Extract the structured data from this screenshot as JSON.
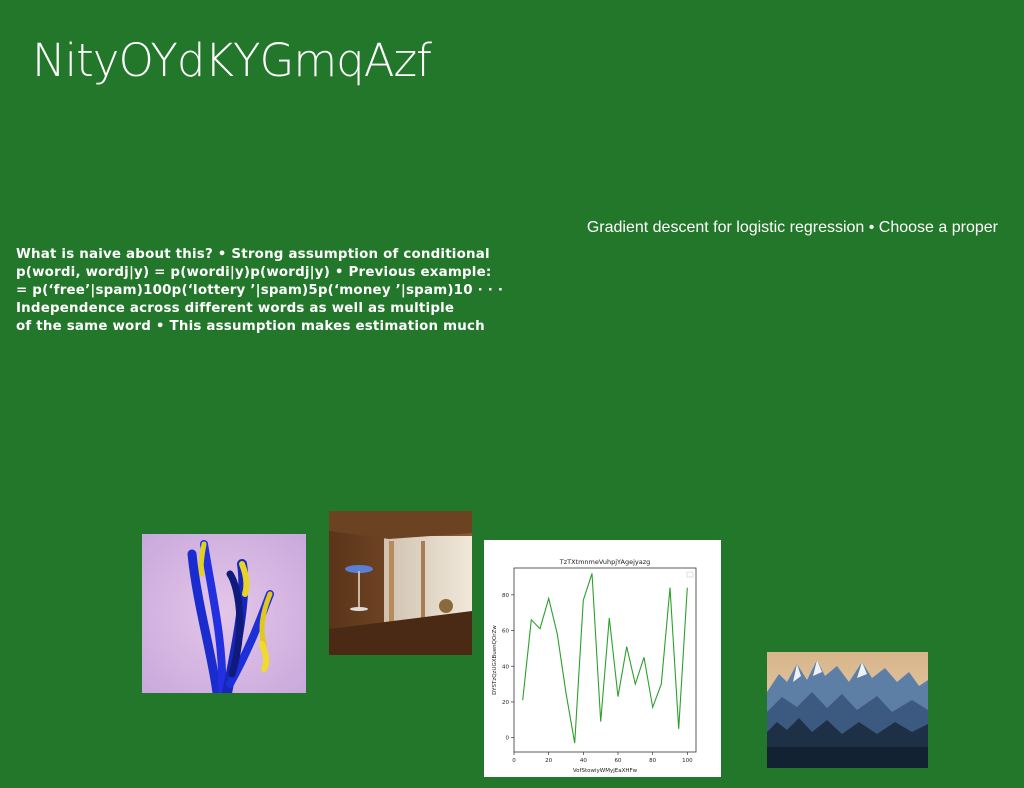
{
  "slide": {
    "title": "NityOYdKYGmqAzf",
    "right_text": "Gradient descent for logistic regression • Choose a proper",
    "body_lines": [
      "What is naive about this? • Strong assumption of conditional",
      "p(wordi, wordj|y) = p(wordi|y)p(wordj|y) • Previous example:",
      "= p(‘free’|spam)100p(‘lottery ’|spam)5p(‘money ’|spam)10 · · ·",
      "Independence across different words as well as multiple",
      "of the same word • This assumption makes estimation much"
    ]
  },
  "images": {
    "img1": "abstract blue and yellow brush strokes",
    "img2": "room interior with table",
    "img4": "snowy mountain peaks with forest"
  },
  "colors": {
    "background": "#23772b",
    "line": "#2ca02c"
  },
  "chart_data": {
    "type": "line",
    "title": "TzTXtmnmeVuhpjYAgejyazg",
    "xlabel": "VofStowiyWMyjEaXHFw",
    "ylabel": "DYSTzQzUGXBuenQOrZw",
    "xlim": [
      0,
      105
    ],
    "ylim": [
      -8,
      95
    ],
    "x_ticks": [
      0,
      20,
      40,
      60,
      80,
      100
    ],
    "y_ticks": [
      0,
      20,
      40,
      60,
      80
    ],
    "series": [
      {
        "x": [
          5,
          10,
          15,
          20,
          25,
          30,
          35,
          40,
          45,
          50,
          55,
          60,
          65,
          70,
          75,
          80,
          85,
          90,
          95,
          100
        ],
        "values": [
          21,
          66,
          61,
          78,
          58,
          25,
          -3,
          77,
          92,
          9,
          67,
          23,
          51,
          30,
          45,
          17,
          30,
          84,
          5,
          84
        ]
      }
    ]
  }
}
